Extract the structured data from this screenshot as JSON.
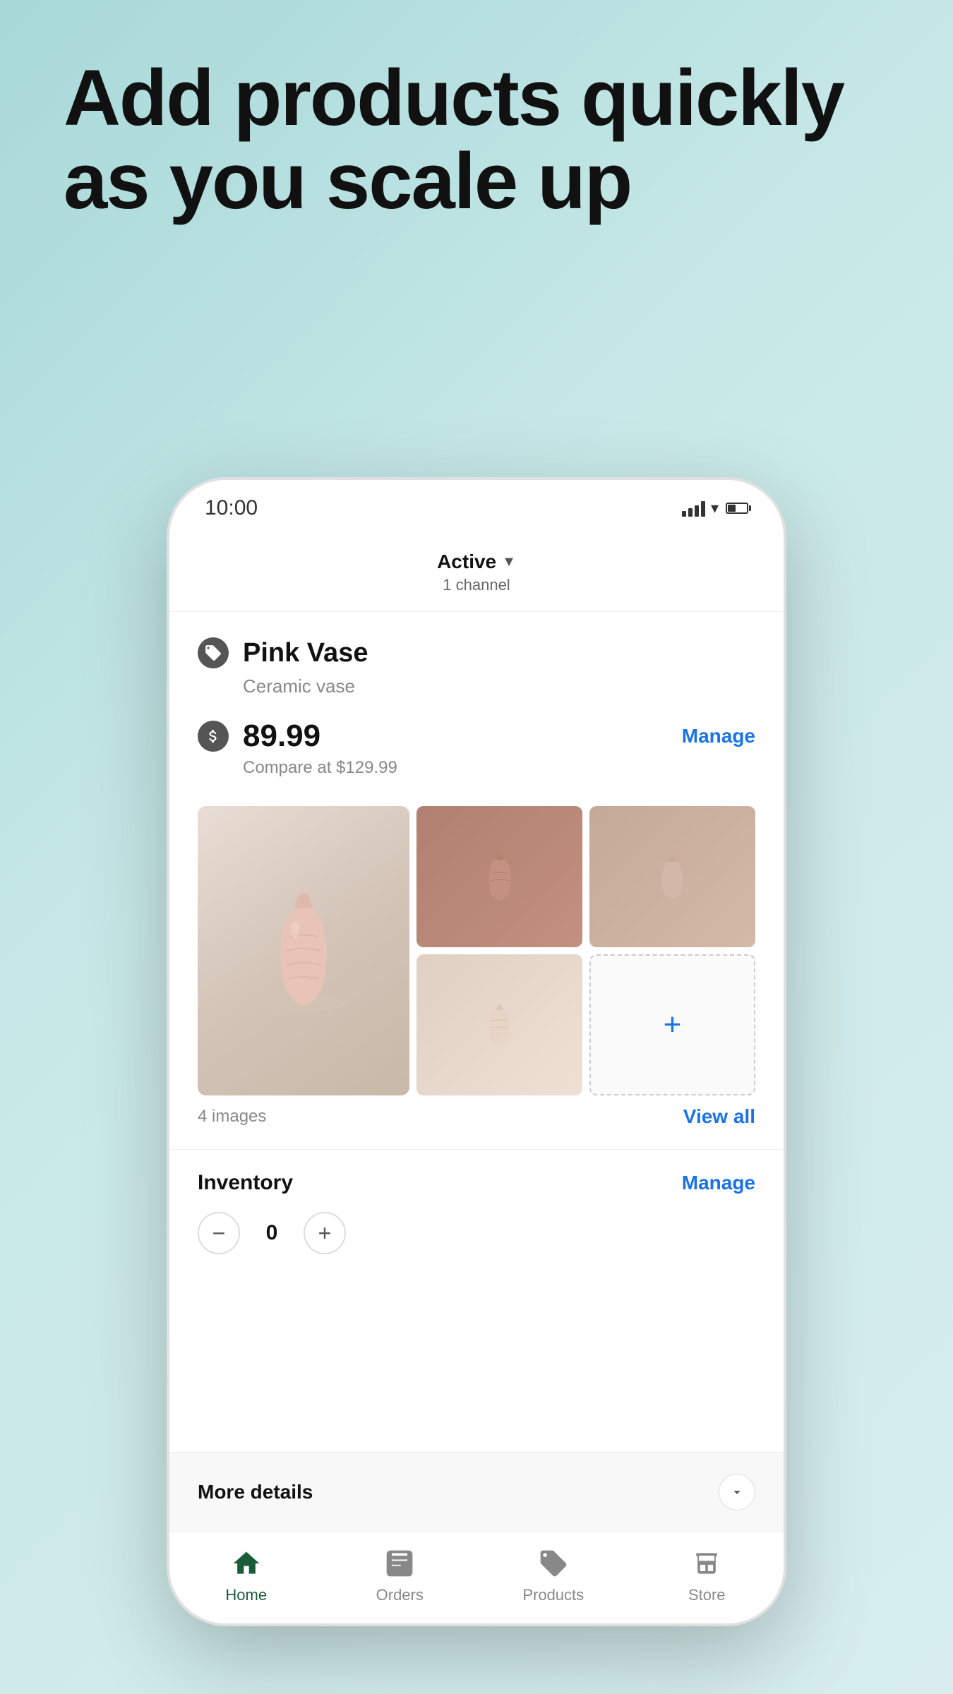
{
  "hero": {
    "title": "Add products quickly as you scale up"
  },
  "statusBar": {
    "time": "10:00"
  },
  "header": {
    "status": "Active",
    "channelCount": "1 channel"
  },
  "product": {
    "name": "Pink Vase",
    "description": "Ceramic vase",
    "price": "89.99",
    "compareAt": "Compare at $129.99",
    "manageLabel": "Manage",
    "imagesCount": "4 images",
    "viewAllLabel": "View all"
  },
  "inventory": {
    "title": "Inventory",
    "manageLabel": "Manage",
    "quantity": "0",
    "decrementLabel": "−",
    "incrementLabel": "+"
  },
  "moreDetails": {
    "label": "More details"
  },
  "bottomNav": {
    "items": [
      {
        "label": "Home",
        "active": true,
        "icon": "home-icon"
      },
      {
        "label": "Orders",
        "active": false,
        "icon": "orders-icon"
      },
      {
        "label": "Products",
        "active": false,
        "icon": "products-icon"
      },
      {
        "label": "Store",
        "active": false,
        "icon": "store-icon"
      }
    ]
  }
}
